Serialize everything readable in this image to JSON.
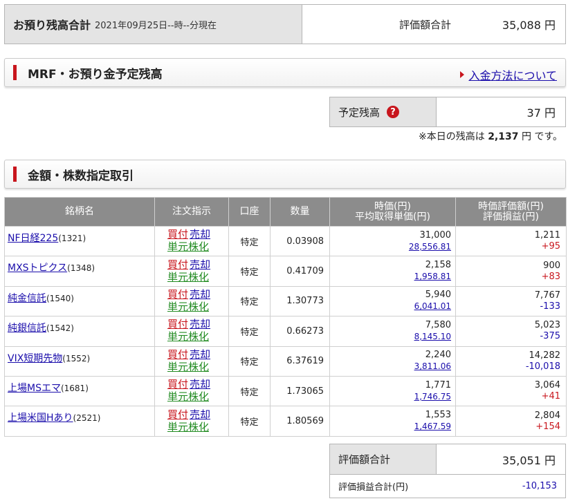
{
  "summary": {
    "title": "お預り残高合計",
    "as_of": "2021年09月25日--時--分現在",
    "total_label": "評価額合計",
    "total_value": "35,088 円"
  },
  "mrf_section": {
    "title": "MRF・お預り金予定残高",
    "link_label": "入金方法について",
    "reserve_label": "予定残高",
    "reserve_help": "?",
    "reserve_value": "37 円",
    "today_prefix": "※本日の残高は",
    "today_value": "2,137",
    "today_suffix": "円 です。"
  },
  "trade_section": {
    "title": "金額・株数指定取引"
  },
  "table": {
    "headers": {
      "name": "銘柄名",
      "order": "注文指示",
      "account": "口座",
      "qty": "数量",
      "price_line1": "時価(円)",
      "price_line2": "平均取得単価(円)",
      "value_line1": "時価評価額(円)",
      "value_line2": "評価損益(円)"
    },
    "order_labels": {
      "buy": "買付",
      "sell": "売却",
      "tangen": "単元株化"
    },
    "rows": [
      {
        "name": "NF日経225",
        "code": "(1321)",
        "account": "特定",
        "qty": "0.03908",
        "price": "31,000",
        "avg": "28,556.81",
        "value": "1,211",
        "pnl": "+95"
      },
      {
        "name": "MXSトピクス",
        "code": "(1348)",
        "account": "特定",
        "qty": "0.41709",
        "price": "2,158",
        "avg": "1,958.81",
        "value": "900",
        "pnl": "+83"
      },
      {
        "name": "純金信託",
        "code": "(1540)",
        "account": "特定",
        "qty": "1.30773",
        "price": "5,940",
        "avg": "6,041.01",
        "value": "7,767",
        "pnl": "-133"
      },
      {
        "name": "純銀信託",
        "code": "(1542)",
        "account": "特定",
        "qty": "0.66273",
        "price": "7,580",
        "avg": "8,145.10",
        "value": "5,023",
        "pnl": "-375"
      },
      {
        "name": "VIX短期先物",
        "code": "(1552)",
        "account": "特定",
        "qty": "6.37619",
        "price": "2,240",
        "avg": "3,811.06",
        "value": "14,282",
        "pnl": "-10,018"
      },
      {
        "name": "上場MSエマ",
        "code": "(1681)",
        "account": "特定",
        "qty": "1.73065",
        "price": "1,771",
        "avg": "1,746.75",
        "value": "3,064",
        "pnl": "+41"
      },
      {
        "name": "上場米国Hあり",
        "code": "(2521)",
        "account": "特定",
        "qty": "1.80569",
        "price": "1,553",
        "avg": "1,467.59",
        "value": "2,804",
        "pnl": "+154"
      }
    ]
  },
  "footer": {
    "total_label": "評価額合計",
    "total_value": "35,051 円",
    "pnl_label": "評価損益合計(円)",
    "pnl_value": "-10,153"
  },
  "colors": {
    "accent_red": "#c8161d",
    "link_blue": "#1a0dab",
    "header_gray": "#8c8c8c",
    "label_gray": "#e4e4e4",
    "tangen_green": "#228b22"
  }
}
